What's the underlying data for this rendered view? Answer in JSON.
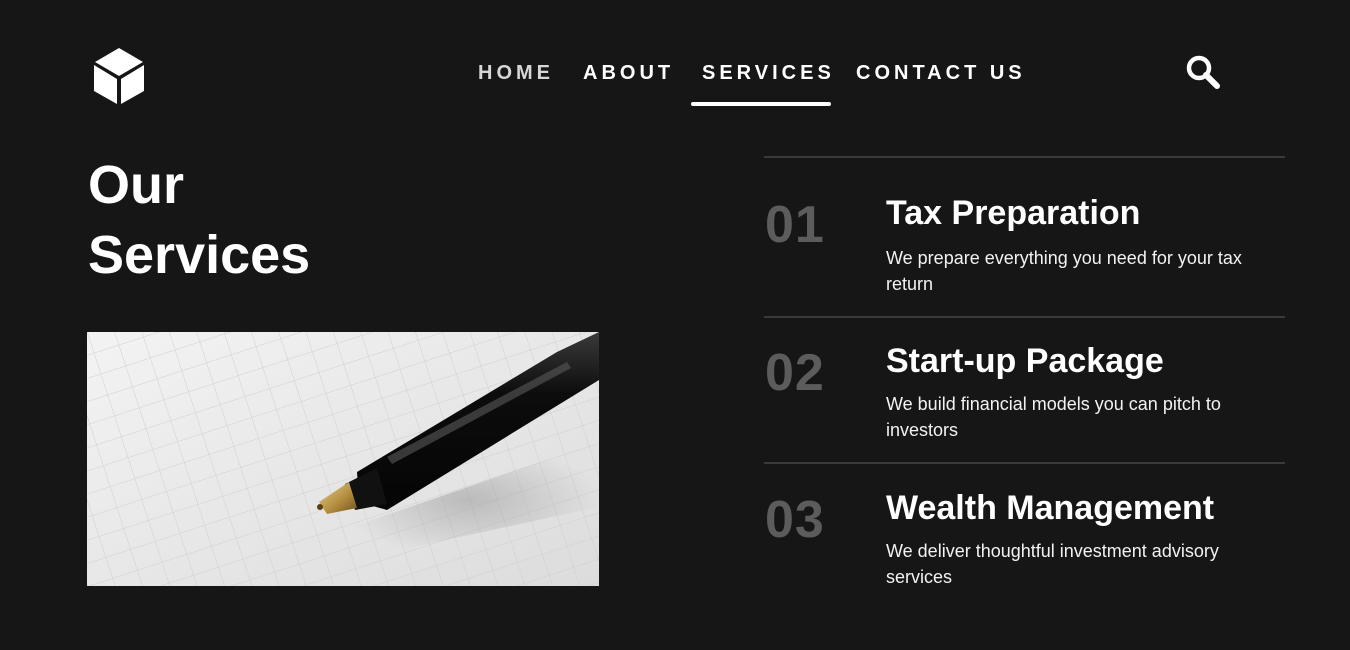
{
  "nav": {
    "items": [
      {
        "label": "HOME"
      },
      {
        "label": "ABOUT"
      },
      {
        "label": "SERVICES",
        "active": true
      },
      {
        "label": "CONTACT US"
      }
    ],
    "logo_icon": "cube-icon",
    "search_icon": "search-icon"
  },
  "hero": {
    "title_line1": "Our",
    "title_line2": "Services",
    "image_subject": "pen-on-grid-paper-image"
  },
  "services": [
    {
      "number": "01",
      "title": "Tax Preparation",
      "description": "We prepare everything you need for your tax return"
    },
    {
      "number": "02",
      "title": "Start-up Package",
      "description": "We build financial models you can pitch to investors"
    },
    {
      "number": "03",
      "title": "Wealth Management",
      "description": "We deliver thoughtful investment advisory services"
    }
  ],
  "colors": {
    "background": "#161616",
    "text": "#ffffff",
    "number": "#5c5c5c",
    "divider": "#3a3a3a"
  }
}
